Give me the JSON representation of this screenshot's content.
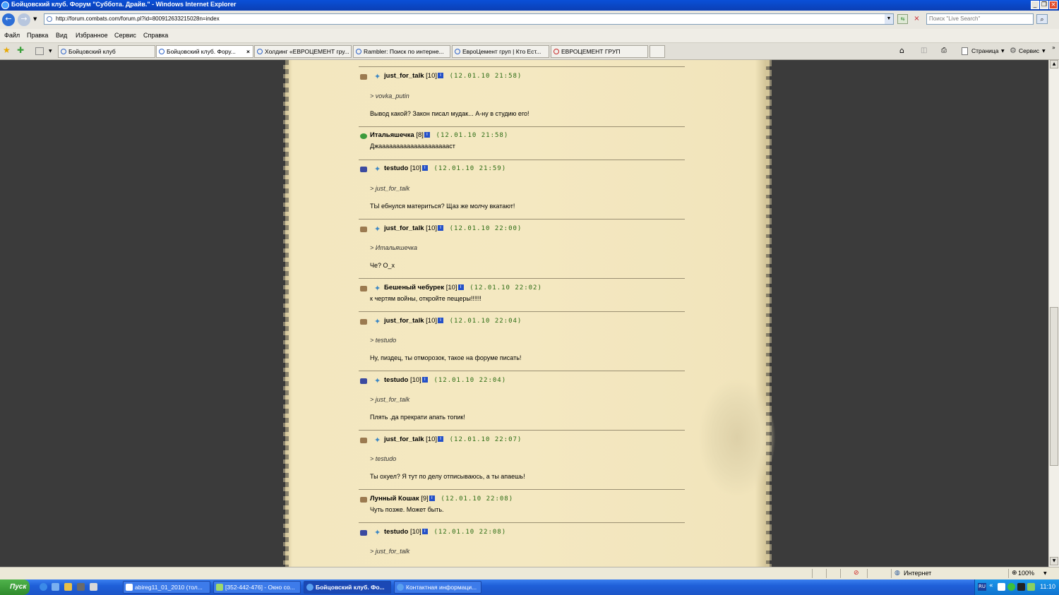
{
  "window": {
    "title": "Бойцовский клуб. Форум \"Суббота. Драйв.\" - Windows Internet Explorer"
  },
  "address": {
    "url": "http://forum.combats.com/forum.pl?id=800912633215028n=index",
    "search_placeholder": "Поиск \"Live Search\""
  },
  "menu": [
    "Файл",
    "Правка",
    "Вид",
    "Избранное",
    "Сервис",
    "Справка"
  ],
  "tabs": [
    {
      "label": "Бойцовский клуб",
      "active": false
    },
    {
      "label": "Бойцовский клуб. Фору...",
      "active": true
    },
    {
      "label": "Холдинг «ЕВРОЦЕМЕНТ гру...",
      "active": false
    },
    {
      "label": "Rambler: Поиск по интерне...",
      "active": false
    },
    {
      "label": "ЕвроЦемент груп | Кто Ест...",
      "active": false
    },
    {
      "label": "ЕВРОЦЕМЕНТ ГРУП",
      "active": false
    }
  ],
  "commands": {
    "page": "Страница",
    "tools": "Сервис"
  },
  "posts": [
    {
      "author": "just_for_talk",
      "level": "[10]",
      "time": "(12.01.10 21:58)",
      "quote": "> vovka_putin",
      "text": "Вывод какой? Закон писал мудак... А-ну в студию его!"
    },
    {
      "author": "Итальяшечка",
      "level": "[8]",
      "time": "(12.01.10 21:58)",
      "quote": "",
      "text": "Джааааааааааааааааааааст"
    },
    {
      "author": "testudo",
      "level": "[10]",
      "time": "(12.01.10 21:59)",
      "quote": "> just_for_talk",
      "text": "ТЫ ебнулся материться? Щаз же молчу вкатают!"
    },
    {
      "author": "just_for_talk",
      "level": "[10]",
      "time": "(12.01.10 22:00)",
      "quote": "> Итальяшечка",
      "text": "Че? О_х"
    },
    {
      "author": "Бешеный чебурек",
      "level": "[10]",
      "time": "(12.01.10 22:02)",
      "quote": "",
      "text": "к чертям войны, откройте пещеры!!!!!!"
    },
    {
      "author": "just_for_talk",
      "level": "[10]",
      "time": "(12.01.10 22:04)",
      "quote": "> testudo",
      "text": "Ну, пиздец, ты отморозок, такое на форуме писать!"
    },
    {
      "author": "testudo",
      "level": "[10]",
      "time": "(12.01.10 22:04)",
      "quote": "> just_for_talk",
      "text": "Плять .да прекрати апать топик!"
    },
    {
      "author": "just_for_talk",
      "level": "[10]",
      "time": "(12.01.10 22:07)",
      "quote": "> testudo",
      "text": "Ты охуел? Я тут по делу отписываюсь, а ты апаешь!"
    },
    {
      "author": "Лунный Кошак",
      "level": "[9]",
      "time": "(12.01.10 22:08)",
      "quote": "",
      "text": "Чуть позже. Может быть."
    },
    {
      "author": "testudo",
      "level": "[10]",
      "time": "(12.01.10 22:08)",
      "quote": "> just_for_talk",
      "text": ""
    }
  ],
  "status": {
    "zone": "Интернет",
    "zoom": "100%"
  },
  "taskbar": {
    "start": "Пуск",
    "buttons": [
      {
        "label": "abireg11_01_2010 (тол...",
        "active": false
      },
      {
        "label": "[352-442-476] - Окно со...",
        "active": false
      },
      {
        "label": "Бойцовский клуб. Фо...",
        "active": true
      },
      {
        "label": "Контактная информаци...",
        "active": false
      }
    ],
    "lang": "RU",
    "clock": "11:10"
  },
  "colors": {
    "paper": "#f4e8c1",
    "background": "#3b3b3b",
    "time": "#2a6b12",
    "titlebar": "#0a50d8"
  }
}
